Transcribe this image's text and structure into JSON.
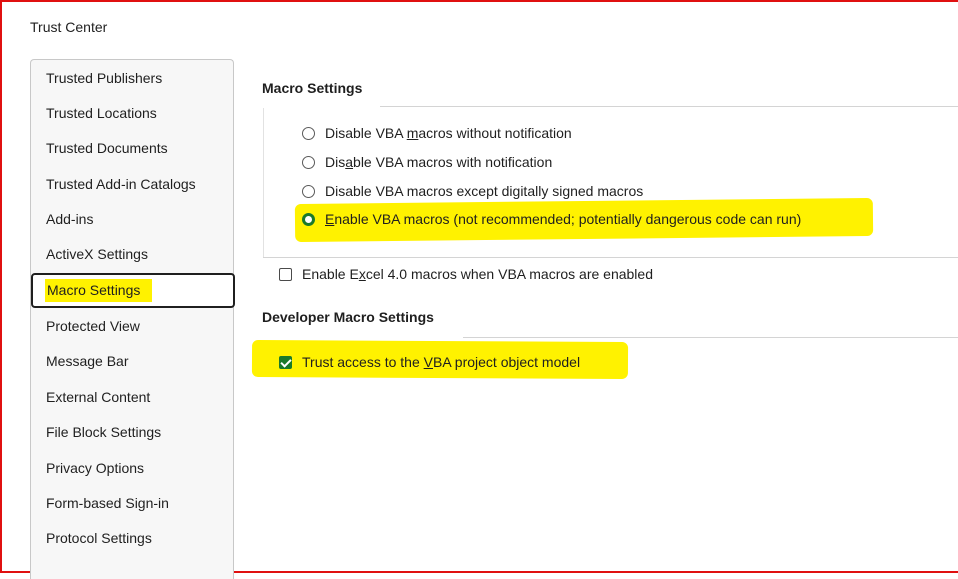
{
  "window": {
    "title": "Trust Center"
  },
  "sidebar": {
    "items": [
      {
        "label": "Trusted Publishers"
      },
      {
        "label": "Trusted Locations"
      },
      {
        "label": "Trusted Documents"
      },
      {
        "label": "Trusted Add-in Catalogs"
      },
      {
        "label": "Add-ins"
      },
      {
        "label": "ActiveX Settings"
      },
      {
        "label": "Macro Settings",
        "selected": true
      },
      {
        "label": "Protected View"
      },
      {
        "label": "Message Bar"
      },
      {
        "label": "External Content"
      },
      {
        "label": "File Block Settings"
      },
      {
        "label": "Privacy Options"
      },
      {
        "label": "Form-based Sign-in"
      },
      {
        "label": "Protocol Settings"
      }
    ]
  },
  "macro_settings": {
    "title": "Macro Settings",
    "options": [
      {
        "pre": "Disable VBA ",
        "key": "m",
        "post": "acros without notification",
        "checked": false
      },
      {
        "pre": "Dis",
        "key": "a",
        "post": "ble VBA macros with notification",
        "checked": false
      },
      {
        "pre": "Disable VBA macros except digitally signed macros",
        "key": "",
        "post": "",
        "checked": false
      },
      {
        "pre": "",
        "key": "E",
        "post": "nable VBA macros (not recommended; potentially dangerous code can run)",
        "checked": true
      }
    ],
    "excel4": {
      "pre": "Enable E",
      "key": "x",
      "post": "cel 4.0 macros when VBA macros are enabled",
      "checked": false
    }
  },
  "developer": {
    "title": "Developer Macro Settings",
    "trust_vba": {
      "pre": "Trust access to the ",
      "key": "V",
      "post": "BA project object model",
      "checked": true
    }
  },
  "colors": {
    "frame_border": "#e01010",
    "highlight": "#fff200",
    "accent_green": "#1a7a2a"
  }
}
